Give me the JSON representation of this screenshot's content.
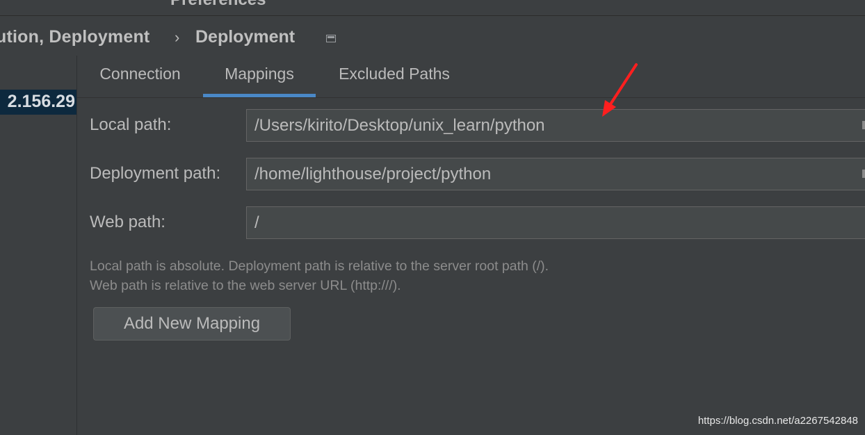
{
  "window": {
    "title": "Preferences"
  },
  "breadcrumb": {
    "parent": "ution, Deployment",
    "separator": "›",
    "current": "Deployment",
    "icon": "window-icon"
  },
  "sidebar": {
    "selected_server": "2.156.29"
  },
  "tabs": [
    {
      "label": "Connection",
      "active": false
    },
    {
      "label": "Mappings",
      "active": true
    },
    {
      "label": "Excluded Paths",
      "active": false
    }
  ],
  "form": {
    "local_path": {
      "label": "Local path:",
      "value": "/Users/kirito/Desktop/unix_learn/python"
    },
    "deployment_path": {
      "label": "Deployment path:",
      "value": "/home/lighthouse/project/python"
    },
    "web_path": {
      "label": "Web path:",
      "value": "/"
    }
  },
  "hints": [
    "Local path is absolute. Deployment path is relative to the server root path (/).",
    "Web path is relative to the web server URL (http:///)."
  ],
  "buttons": {
    "add_mapping": "Add New Mapping"
  },
  "annotation": {
    "arrow_color": "#ff1f1f",
    "icon": "red-arrow"
  },
  "watermark": "https://blog.csdn.net/a2267542848",
  "colors": {
    "background": "#3c3f41",
    "selection": "#0d293e",
    "tab_underline": "#4a88c7",
    "input_bg": "#45494a"
  }
}
